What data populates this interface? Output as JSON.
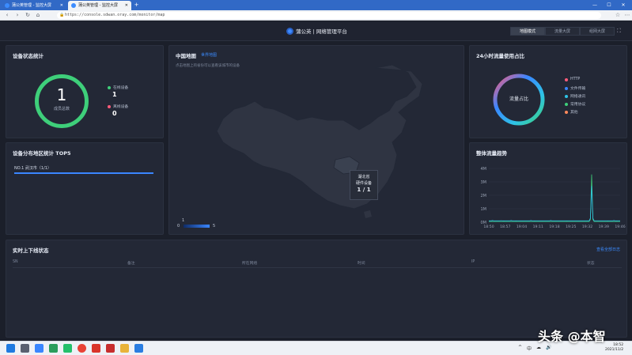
{
  "browser": {
    "tabs": [
      {
        "label": "蒲公英管理 - 监控大屏"
      },
      {
        "label": "蒲公英管理 - 监控大屏"
      }
    ],
    "new_tab": "+",
    "url": "https://console.sdwan.oray.com/monitor/map",
    "window_controls": {
      "minimize": "—",
      "maximize": "☐",
      "close": "✕"
    }
  },
  "header": {
    "brand": "蒲公英 | 网络管理平台",
    "modes": [
      {
        "label": "地图模式",
        "active": true
      },
      {
        "label": "流量大屏",
        "active": false
      },
      {
        "label": "组网大屏",
        "active": false
      }
    ],
    "fullscreen_icon": "⛶"
  },
  "device_status": {
    "title": "设备状态统计",
    "total": "1",
    "total_label": "成员总数",
    "legend": [
      {
        "label": "在线设备",
        "value": "1",
        "color": "#3ecf7a"
      },
      {
        "label": "离线设备",
        "value": "0",
        "color": "#ff5b7a"
      }
    ]
  },
  "region": {
    "title": "设备分布地区统计 TOP5",
    "rows": [
      {
        "label": "NO.1  武汉市（1/1）",
        "fraction": 1.0
      }
    ]
  },
  "map": {
    "title": "中国地图",
    "subtitle": "世界地图",
    "hint": "点击地图上的省份可以查看该城市的设备",
    "tooltip": {
      "region": "湖北省",
      "label": "硬件设备",
      "value": "1 / 1"
    },
    "scale": {
      "max_top": "1",
      "min": "0",
      "max": "5"
    }
  },
  "traffic": {
    "title": "24小时流量使用占比",
    "center_label": "流量占比",
    "legend": [
      {
        "label": "HTTP",
        "color": "#ff5b7a"
      },
      {
        "label": "文件传输",
        "color": "#3a86ff"
      },
      {
        "label": "网络通讯",
        "color": "#2ec4e6"
      },
      {
        "label": "常用协议",
        "color": "#3ecf7a"
      },
      {
        "label": "其他",
        "color": "#ff8a5b"
      }
    ]
  },
  "trend": {
    "title": "整体流量趋势",
    "chart_data": {
      "type": "line",
      "x": [
        "18:50",
        "18:57",
        "19:04",
        "19:11",
        "19:18",
        "19:25",
        "19:32",
        "19:39",
        "19:46"
      ],
      "y_ticks": [
        "0M",
        "1M",
        "2M",
        "3M",
        "4M"
      ],
      "ylim": [
        0,
        4
      ],
      "series": [
        {
          "color": "#3ecf7a",
          "values": [
            0.05,
            0.05,
            0.06,
            0.05,
            0.05,
            0.05,
            0.05,
            0.05,
            0.05,
            0.05,
            0.05,
            0.05,
            0.06,
            0.05,
            0.05,
            0.05,
            0.05,
            0.05,
            0.05,
            0.05,
            0.05,
            0.05,
            0.06,
            0.05,
            0.05,
            0.05,
            0.05,
            0.05,
            0.05,
            0.05,
            0.05,
            0.05,
            0.05,
            0.05,
            0.05,
            0.05,
            0.05,
            0.06,
            0.05,
            0.05,
            0.05,
            0.05,
            0.05,
            0.05,
            0.05,
            0.05,
            0.05,
            0.05,
            0.05,
            0.05,
            0.05,
            0.05,
            0.05,
            0.05,
            0.05,
            0.05,
            0.05,
            0.05,
            0.05,
            0.05,
            0.05,
            0.05,
            0.05,
            0.06,
            0.05,
            0.05,
            0.05,
            0.05,
            0.05,
            0.05,
            0.05,
            0.05,
            0.05,
            0.05,
            0.05,
            0.05,
            0.05,
            0.05,
            0.05,
            0.05,
            0.05,
            0.05,
            0.2,
            3.55,
            0.2,
            0.05,
            0.05,
            0.05,
            0.05,
            0.05,
            0.05,
            0.05,
            0.05,
            0.05,
            0.05,
            0.05,
            0.06,
            0.05,
            0.05,
            0.05,
            0.05,
            0.05,
            0.05,
            0.06,
            0.05,
            0.05,
            0.05
          ]
        },
        {
          "color": "#2ec4e6",
          "values": [
            0.1,
            0.1,
            0.1,
            0.12,
            0.1,
            0.1,
            0.1,
            0.1,
            0.1,
            0.1,
            0.11,
            0.1,
            0.1,
            0.1,
            0.1,
            0.1,
            0.1,
            0.1,
            0.12,
            0.1,
            0.1,
            0.1,
            0.1,
            0.1,
            0.1,
            0.1,
            0.1,
            0.1,
            0.1,
            0.1,
            0.1,
            0.1,
            0.1,
            0.1,
            0.12,
            0.1,
            0.1,
            0.1,
            0.1,
            0.1,
            0.1,
            0.1,
            0.1,
            0.1,
            0.1,
            0.1,
            0.1,
            0.1,
            0.1,
            0.1,
            0.12,
            0.1,
            0.1,
            0.1,
            0.1,
            0.1,
            0.1,
            0.1,
            0.1,
            0.1,
            0.1,
            0.1,
            0.1,
            0.1,
            0.1,
            0.1,
            0.1,
            0.1,
            0.1,
            0.1,
            0.1,
            0.1,
            0.1,
            0.1,
            0.1,
            0.1,
            0.1,
            0.1,
            0.1,
            0.1,
            0.1,
            0.1,
            0.3,
            2.7,
            0.3,
            0.1,
            0.1,
            0.1,
            0.1,
            0.1,
            0.1,
            0.1,
            0.1,
            0.1,
            0.1,
            0.1,
            0.1,
            0.1,
            0.1,
            0.1,
            0.1,
            0.12,
            0.1,
            0.1,
            0.1,
            0.1,
            0.1
          ]
        }
      ]
    }
  },
  "table": {
    "title": "实时上下线状态",
    "link": "查看全部日志",
    "columns": [
      "SN",
      "备注",
      "所在网络",
      "时间",
      "IP",
      "状态"
    ]
  },
  "taskbar": {
    "tray": [
      "^",
      "中",
      "☁",
      "🔊"
    ],
    "time": "18:52",
    "date": "2021/11/2"
  },
  "watermark": "头条 @本智"
}
